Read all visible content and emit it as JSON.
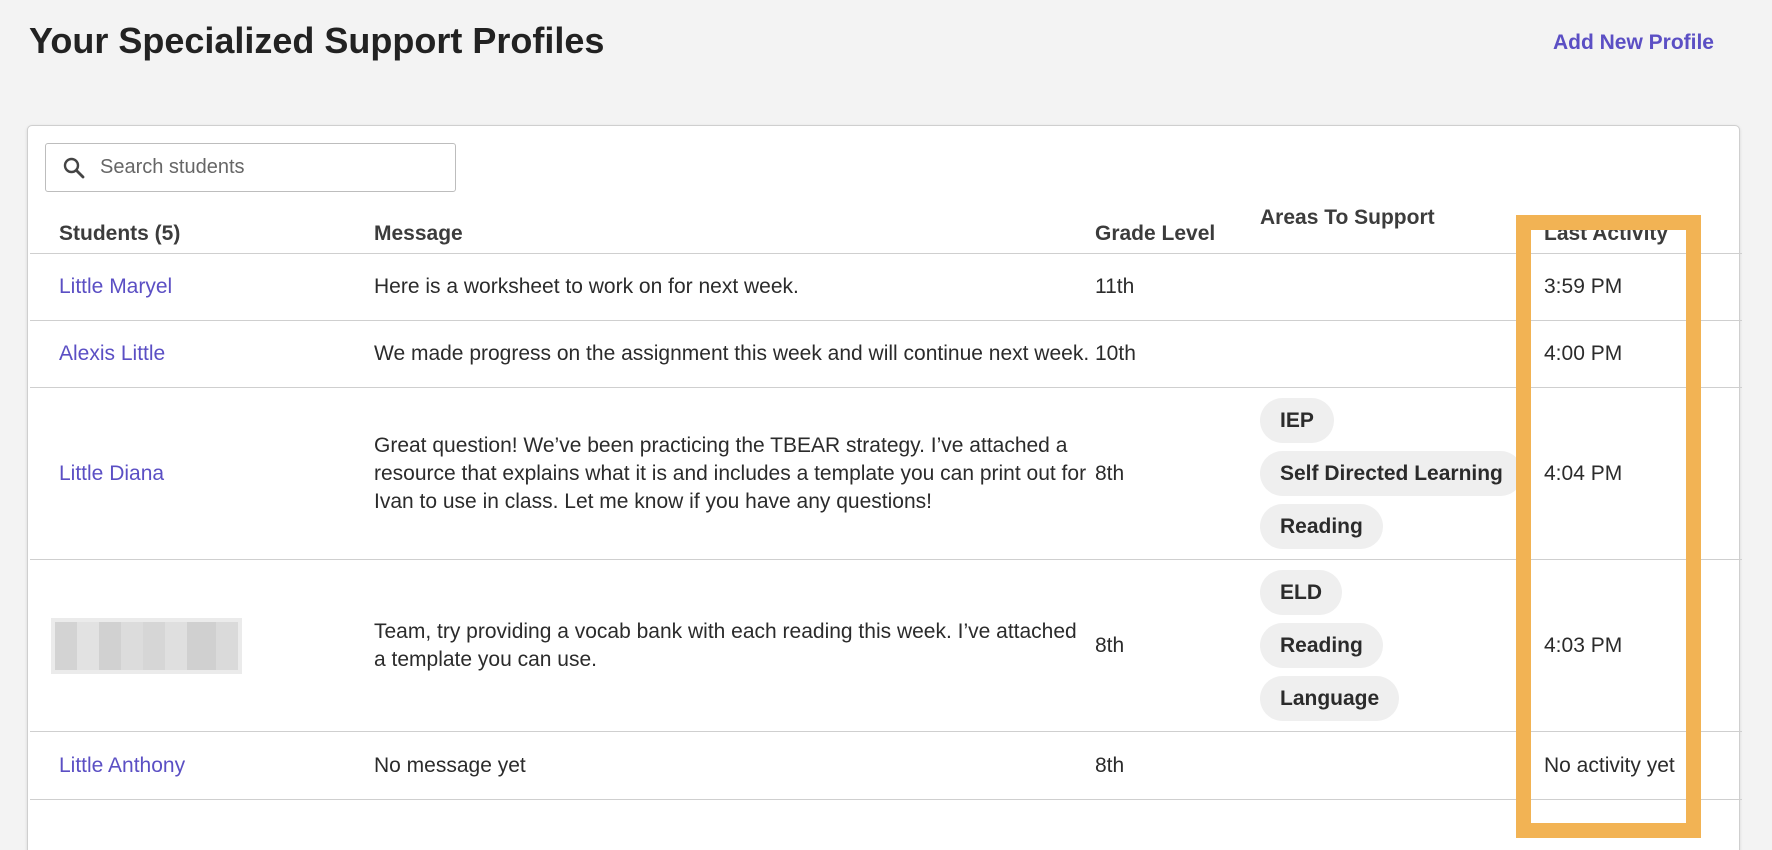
{
  "header": {
    "title": "Your Specialized Support Profiles",
    "add_profile_label": "Add New Profile"
  },
  "search": {
    "placeholder": "Search students",
    "value": ""
  },
  "table": {
    "columns": {
      "students": "Students (5)",
      "message": "Message",
      "grade": "Grade Level",
      "areas": "Areas To Support",
      "last_activity": "Last Activity"
    },
    "rows": [
      {
        "name": "Little Maryel",
        "message": "Here is a worksheet to work on for next week.",
        "grade": "11th",
        "areas": [],
        "last_activity": "3:59 PM"
      },
      {
        "name": "Alexis Little",
        "message": "We made progress on the assignment this week and will continue next week.",
        "grade": "10th",
        "areas": [],
        "last_activity": "4:00 PM"
      },
      {
        "name": "Little Diana",
        "message": "Great question! We’ve been practicing the TBEAR strategy. I’ve attached a resource that explains what it is and includes a template you can print out for Ivan to use in class. Let me know if you have any questions!",
        "grade": "8th",
        "areas": [
          "IEP",
          "Self Directed Learning",
          "Reading"
        ],
        "last_activity": "4:04 PM"
      },
      {
        "name": "",
        "message": "Team, try providing a vocab bank with each reading this week. I’ve attached a template you can use.",
        "grade": "8th",
        "areas": [
          "ELD",
          "Reading",
          "Language"
        ],
        "last_activity": "4:03 PM"
      },
      {
        "name": "Little Anthony",
        "message": "No message yet",
        "grade": "8th",
        "areas": [],
        "last_activity": "No activity yet"
      }
    ]
  },
  "colors": {
    "accent": "#5b4fc4",
    "highlight": "#f2b354",
    "chip_bg": "#efefef"
  }
}
